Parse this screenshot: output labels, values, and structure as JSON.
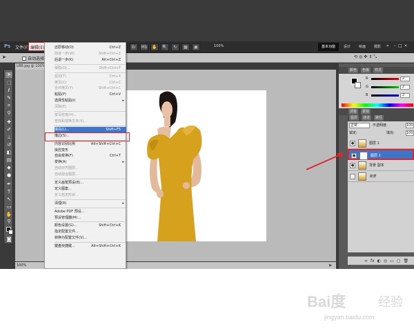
{
  "app": {
    "logo": "Ps",
    "menus": [
      "文件(F)",
      "编辑(E)"
    ],
    "active_menu": "编辑(E)",
    "zoom": "100%",
    "workspace": "基本功能",
    "workspaces": [
      "设计",
      "绘画",
      "摄影"
    ],
    "chevron": "»",
    "window_controls": [
      "–",
      "□",
      "×"
    ]
  },
  "options_bar": {
    "auto_select_label": "自动选择"
  },
  "document": {
    "tab_title": "LBB.jpg @ 100% (图层 2, RGB/8)",
    "status_zoom": "100%",
    "status_arrow": "▶"
  },
  "edit_menu": {
    "items": [
      {
        "label": "还原移动(O)",
        "shortcut": "Ctrl+Z",
        "disabled": false
      },
      {
        "label": "前进一步(W)",
        "shortcut": "Shift+Ctrl+Z",
        "disabled": true
      },
      {
        "label": "后退一步(K)",
        "shortcut": "Alt+Ctrl+Z",
        "disabled": false
      },
      {
        "sep": true
      },
      {
        "label": "渐隐(D)...",
        "shortcut": "Shift+Ctrl+F",
        "disabled": true
      },
      {
        "sep": true
      },
      {
        "label": "剪切(T)",
        "shortcut": "Ctrl+X",
        "disabled": true
      },
      {
        "label": "拷贝(C)",
        "shortcut": "Ctrl+C",
        "disabled": true
      },
      {
        "label": "合并拷贝(Y)",
        "shortcut": "Shift+Ctrl+C",
        "disabled": true
      },
      {
        "label": "粘贴(P)",
        "shortcut": "Ctrl+V",
        "disabled": false
      },
      {
        "label": "选择性粘贴(I)",
        "shortcut": "",
        "disabled": false,
        "submenu": true
      },
      {
        "label": "清除(E)",
        "shortcut": "",
        "disabled": true
      },
      {
        "sep": true
      },
      {
        "label": "拼写检查(H)...",
        "shortcut": "",
        "disabled": true
      },
      {
        "label": "查找和替换文本(X)...",
        "shortcut": "",
        "disabled": true
      },
      {
        "sep": true
      },
      {
        "label": "填充(L)...",
        "shortcut": "Shift+F5",
        "disabled": false,
        "highlighted": true
      },
      {
        "label": "描边(S)...",
        "shortcut": "",
        "disabled": false
      },
      {
        "sep": true
      },
      {
        "label": "内容识别比例",
        "shortcut": "Alt+Shift+Ctrl+C",
        "disabled": false
      },
      {
        "label": "操控变形",
        "shortcut": "",
        "disabled": false
      },
      {
        "label": "自由变换(F)",
        "shortcut": "Ctrl+T",
        "disabled": false
      },
      {
        "label": "变换(A)",
        "shortcut": "",
        "disabled": false,
        "submenu": true
      },
      {
        "label": "自动对齐图层...",
        "shortcut": "",
        "disabled": true
      },
      {
        "label": "自动混合图层...",
        "shortcut": "",
        "disabled": true
      },
      {
        "sep": true
      },
      {
        "label": "定义画笔预设(B)...",
        "shortcut": "",
        "disabled": false
      },
      {
        "label": "定义图案...",
        "shortcut": "",
        "disabled": false
      },
      {
        "label": "定义自定形状...",
        "shortcut": "",
        "disabled": true
      },
      {
        "sep": true
      },
      {
        "label": "清理(R)",
        "shortcut": "",
        "disabled": false,
        "submenu": true
      },
      {
        "sep": true
      },
      {
        "label": "Adobe PDF 预设...",
        "shortcut": "",
        "disabled": false
      },
      {
        "label": "预设管理器(M)...",
        "shortcut": "",
        "disabled": false
      },
      {
        "sep": true
      },
      {
        "label": "颜色设置(G)...",
        "shortcut": "Shift+Ctrl+K",
        "disabled": false
      },
      {
        "label": "指定配置文件...",
        "shortcut": "",
        "disabled": false
      },
      {
        "label": "转换为配置文件(V)...",
        "shortcut": "",
        "disabled": false
      },
      {
        "sep": true
      },
      {
        "label": "键盘快捷键...",
        "shortcut": "Alt+Shift+Ctrl+K",
        "disabled": false
      }
    ]
  },
  "panels": {
    "color_tabs": [
      "颜色",
      "色板",
      "样式"
    ],
    "sliders": [
      {
        "label": "R",
        "value": "2",
        "color": "#e33"
      },
      {
        "label": "G",
        "value": "2",
        "color": "#3c3"
      },
      {
        "label": "B",
        "value": "2",
        "color": "#33d"
      }
    ],
    "adjust_tabs": [
      "调整",
      "蒙版"
    ],
    "layer_tabs": [
      "图层",
      "通道",
      "路径"
    ],
    "blend_mode": "正常",
    "opacity_label": "不透明度:",
    "opacity_value": "100",
    "lock_label": "锁定:",
    "fill_label": "填充:",
    "fill_value": "100",
    "layers": [
      {
        "name": "图层 1",
        "selected": false,
        "italic": false,
        "thumb": "person"
      },
      {
        "name": "图层 2",
        "selected": true,
        "italic": false,
        "thumb": "white"
      },
      {
        "name": "背景 副本",
        "selected": false,
        "italic": false,
        "thumb": "person"
      },
      {
        "name": "背景",
        "selected": false,
        "italic": true,
        "thumb": "person"
      }
    ],
    "footer_icons": [
      "∞",
      "fx",
      "◐",
      "◎",
      "▭",
      "▢",
      "🗑"
    ]
  },
  "colors": {
    "highlight": "#e0262b",
    "selection": "#3d76c9",
    "dress": "#d6a21e"
  },
  "watermark": {
    "logo": "Bai度",
    "jingyan": "经验",
    "url": "jingyan.baidu.com"
  }
}
